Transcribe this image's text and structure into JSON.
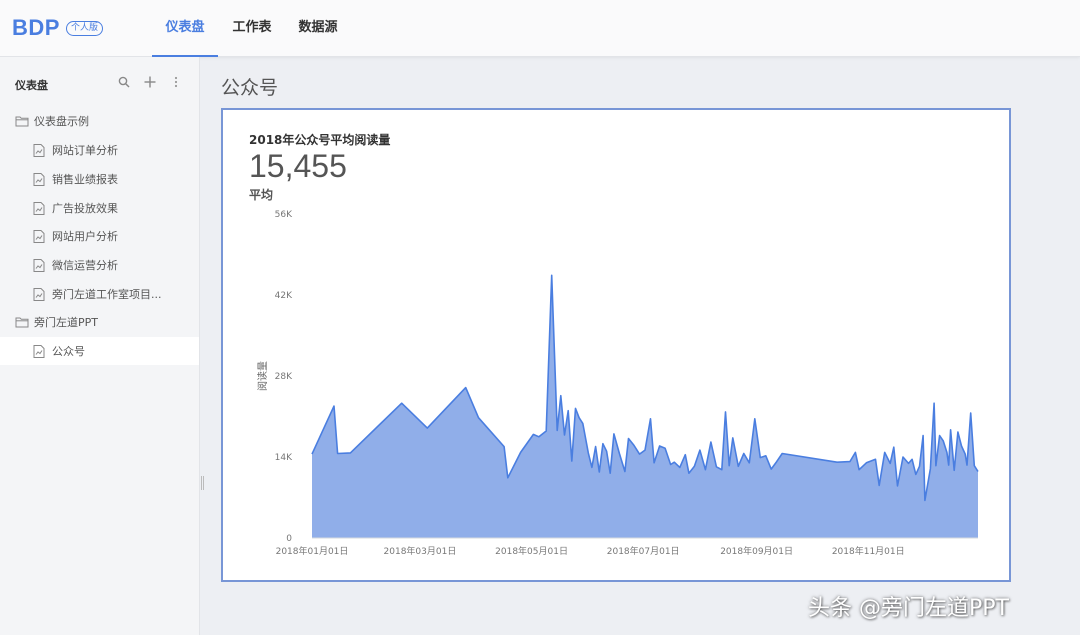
{
  "app": {
    "logo_text": "BDP",
    "logo_badge": "个人版",
    "brand_color": "#4a7ee0"
  },
  "nav": {
    "tabs": [
      {
        "label": "仪表盘",
        "active": true
      },
      {
        "label": "工作表",
        "active": false
      },
      {
        "label": "数据源",
        "active": false
      }
    ]
  },
  "sidebar": {
    "title": "仪表盘",
    "tools": [
      "search-icon",
      "plus-icon",
      "more-vertical-icon"
    ],
    "items": [
      {
        "type": "folder",
        "label": "仪表盘示例",
        "icon": "folder-icon"
      },
      {
        "type": "dashboard",
        "label": "网站订单分析",
        "icon": "dashboard-file-icon"
      },
      {
        "type": "dashboard",
        "label": "销售业绩报表",
        "icon": "dashboard-file-icon"
      },
      {
        "type": "dashboard",
        "label": "广告投放效果",
        "icon": "dashboard-file-icon"
      },
      {
        "type": "dashboard",
        "label": "网站用户分析",
        "icon": "dashboard-file-icon"
      },
      {
        "type": "dashboard",
        "label": "微信运营分析",
        "icon": "dashboard-file-icon"
      },
      {
        "type": "dashboard",
        "label": "旁门左道工作室项目...",
        "icon": "dashboard-file-icon"
      },
      {
        "type": "folder",
        "label": "旁门左道PPT",
        "icon": "folder-icon"
      },
      {
        "type": "dashboard",
        "label": "公众号",
        "icon": "dashboard-file-icon",
        "selected": true
      }
    ]
  },
  "main": {
    "page_title": "公众号",
    "card": {
      "title": "2018年公众号平均阅读量",
      "value": "15,455",
      "value_label": "平均"
    }
  },
  "watermark": "头条 @旁门左道PPT",
  "chart_data": {
    "type": "area",
    "ylabel": "阅读量",
    "xlabel": "",
    "ylim": [
      0,
      56000
    ],
    "y_ticks": [
      "0",
      "14K",
      "28K",
      "42K",
      "56K"
    ],
    "y_tick_values": [
      0,
      14000,
      28000,
      42000,
      56000
    ],
    "x_ticks": [
      "2018年01月01日",
      "2018年03月01日",
      "2018年05月01日",
      "2018年07月01日",
      "2018年09月01日",
      "2018年11月01日"
    ],
    "x_tick_values": [
      "2018-01-01",
      "2018-03-01",
      "2018-05-01",
      "2018-07-01",
      "2018-09-01",
      "2018-11-01"
    ],
    "fill_color": "#90aee9",
    "line_color": "#4a7ee0",
    "series": [
      {
        "points": [
          [
            "2018-01-01",
            14500
          ],
          [
            "2018-01-13",
            22800
          ],
          [
            "2018-01-15",
            14600
          ],
          [
            "2018-01-22",
            14700
          ],
          [
            "2018-02-19",
            23300
          ],
          [
            "2018-03-05",
            19000
          ],
          [
            "2018-03-26",
            26000
          ],
          [
            "2018-04-02",
            20800
          ],
          [
            "2018-04-16",
            15800
          ],
          [
            "2018-04-18",
            10400
          ],
          [
            "2018-04-25",
            14800
          ],
          [
            "2018-05-02",
            17900
          ],
          [
            "2018-05-05",
            17500
          ],
          [
            "2018-05-09",
            18500
          ],
          [
            "2018-05-12",
            45400
          ],
          [
            "2018-05-15",
            18600
          ],
          [
            "2018-05-17",
            24600
          ],
          [
            "2018-05-19",
            17800
          ],
          [
            "2018-05-21",
            22000
          ],
          [
            "2018-05-23",
            13300
          ],
          [
            "2018-05-25",
            22400
          ],
          [
            "2018-05-27",
            20800
          ],
          [
            "2018-05-29",
            19800
          ],
          [
            "2018-06-01",
            14700
          ],
          [
            "2018-06-03",
            12200
          ],
          [
            "2018-06-05",
            15800
          ],
          [
            "2018-06-07",
            11400
          ],
          [
            "2018-06-09",
            16300
          ],
          [
            "2018-06-11",
            15000
          ],
          [
            "2018-06-13",
            11200
          ],
          [
            "2018-06-15",
            18000
          ],
          [
            "2018-06-18",
            14600
          ],
          [
            "2018-06-21",
            11500
          ],
          [
            "2018-06-23",
            17200
          ],
          [
            "2018-06-26",
            16000
          ],
          [
            "2018-06-29",
            14500
          ],
          [
            "2018-07-02",
            15200
          ],
          [
            "2018-07-05",
            20600
          ],
          [
            "2018-07-07",
            13000
          ],
          [
            "2018-07-10",
            15900
          ],
          [
            "2018-07-13",
            15500
          ],
          [
            "2018-07-16",
            12700
          ],
          [
            "2018-07-18",
            13100
          ],
          [
            "2018-07-21",
            12200
          ],
          [
            "2018-07-24",
            14400
          ],
          [
            "2018-07-26",
            11200
          ],
          [
            "2018-07-29",
            12400
          ],
          [
            "2018-08-01",
            15200
          ],
          [
            "2018-08-04",
            11800
          ],
          [
            "2018-08-07",
            16600
          ],
          [
            "2018-08-10",
            12300
          ],
          [
            "2018-08-13",
            11800
          ],
          [
            "2018-08-15",
            21800
          ],
          [
            "2018-08-17",
            12500
          ],
          [
            "2018-08-19",
            17300
          ],
          [
            "2018-08-22",
            12400
          ],
          [
            "2018-08-25",
            14600
          ],
          [
            "2018-08-28",
            13000
          ],
          [
            "2018-08-31",
            20600
          ],
          [
            "2018-09-03",
            13900
          ],
          [
            "2018-09-06",
            14200
          ],
          [
            "2018-09-09",
            11900
          ],
          [
            "2018-09-12",
            13200
          ],
          [
            "2018-09-15",
            14600
          ],
          [
            "2018-10-15",
            13100
          ],
          [
            "2018-10-22",
            13200
          ],
          [
            "2018-10-25",
            14800
          ],
          [
            "2018-10-27",
            11800
          ],
          [
            "2018-10-31",
            13000
          ],
          [
            "2018-11-05",
            13600
          ],
          [
            "2018-11-07",
            9100
          ],
          [
            "2018-11-10",
            14800
          ],
          [
            "2018-11-13",
            12900
          ],
          [
            "2018-11-15",
            15700
          ],
          [
            "2018-11-17",
            9000
          ],
          [
            "2018-11-20",
            14000
          ],
          [
            "2018-11-23",
            12900
          ],
          [
            "2018-11-25",
            13600
          ],
          [
            "2018-11-27",
            11000
          ],
          [
            "2018-11-29",
            12400
          ],
          [
            "2018-12-01",
            17700
          ],
          [
            "2018-12-02",
            6500
          ],
          [
            "2018-12-05",
            12000
          ],
          [
            "2018-12-07",
            23300
          ],
          [
            "2018-12-08",
            12500
          ],
          [
            "2018-12-10",
            17700
          ],
          [
            "2018-12-12",
            16800
          ],
          [
            "2018-12-14",
            14800
          ],
          [
            "2018-12-15",
            12600
          ],
          [
            "2018-12-16",
            18700
          ],
          [
            "2018-12-18",
            11700
          ],
          [
            "2018-12-20",
            18300
          ],
          [
            "2018-12-22",
            15900
          ],
          [
            "2018-12-24",
            14500
          ],
          [
            "2018-12-25",
            12600
          ],
          [
            "2018-12-27",
            21600
          ],
          [
            "2018-12-29",
            12500
          ],
          [
            "2018-12-31",
            11500
          ]
        ]
      }
    ]
  }
}
